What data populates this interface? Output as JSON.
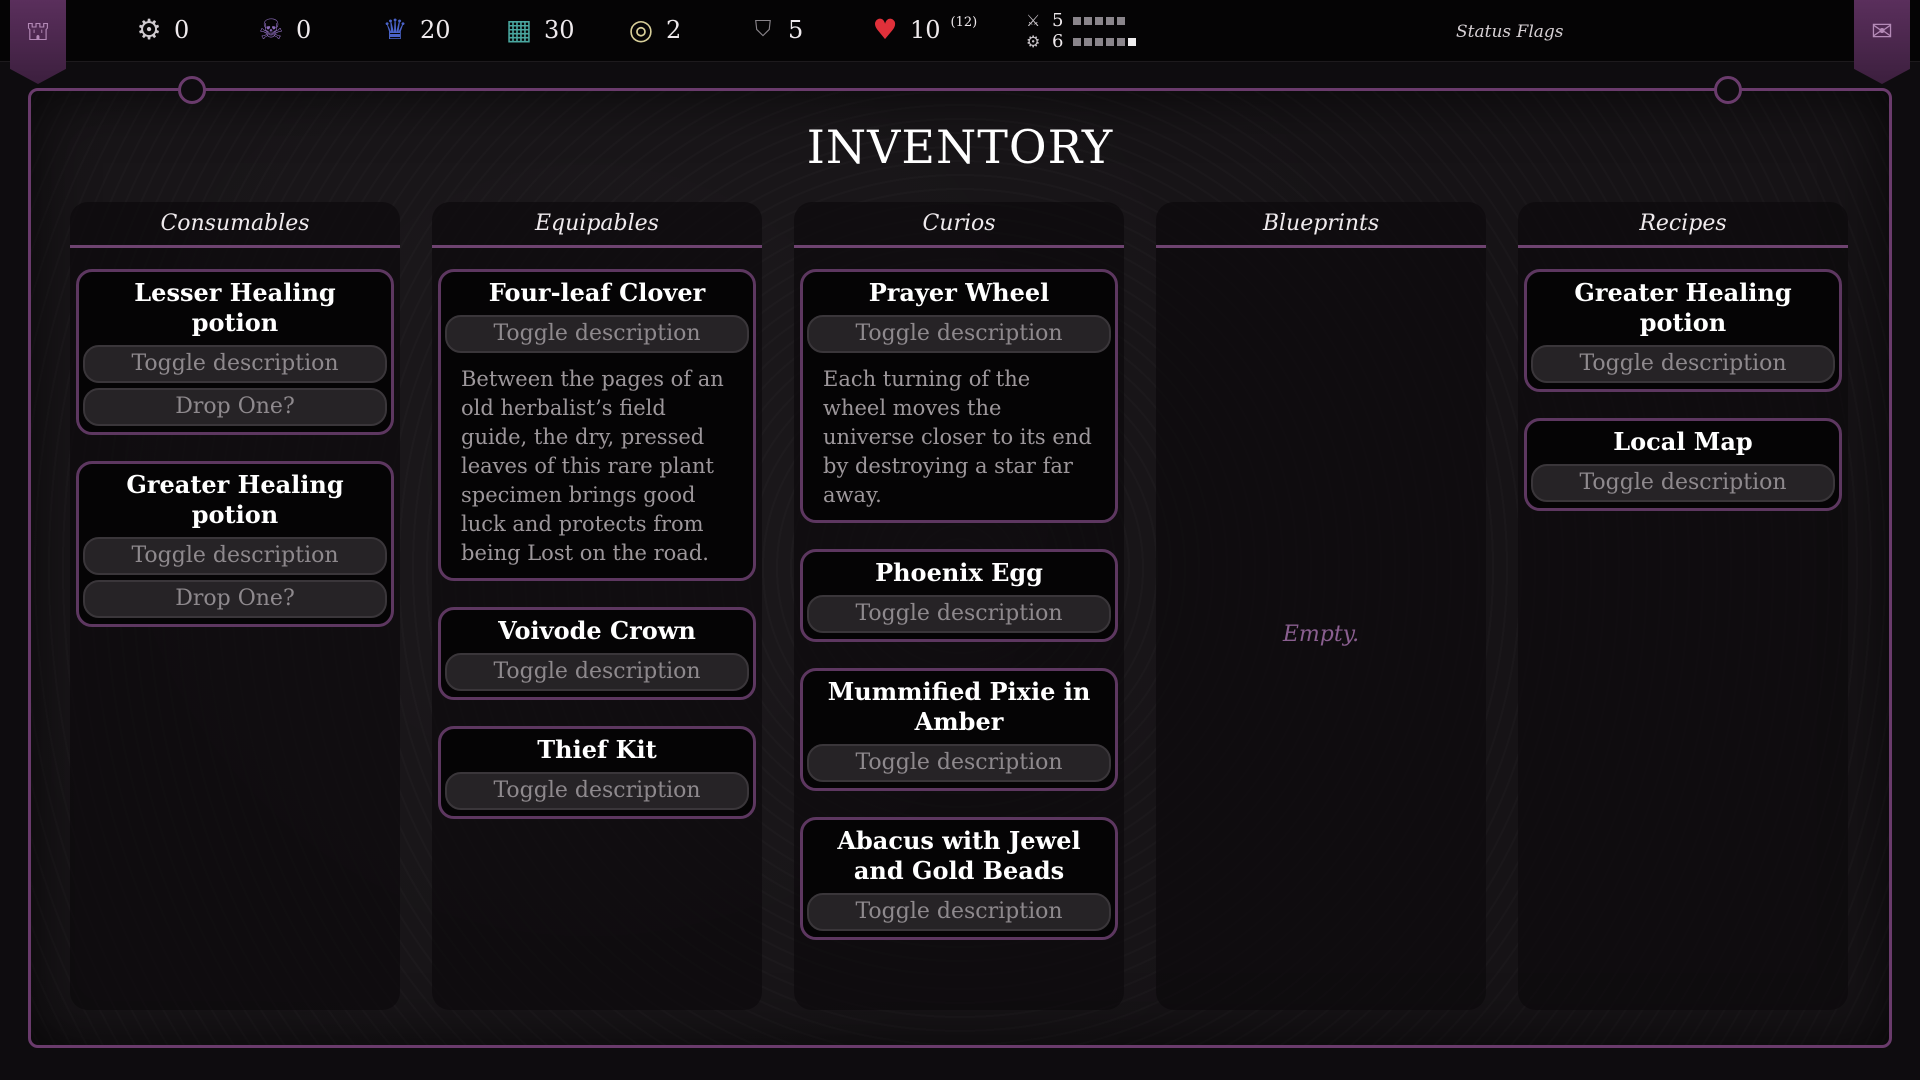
{
  "topbar": {
    "left_tab_icon": "castle-map-icon",
    "right_tab_icon": "scroll-icon",
    "stats": [
      {
        "icon": "gear-icon",
        "value": "0"
      },
      {
        "icon": "skull-gear-icon",
        "value": "0"
      },
      {
        "icon": "trophy-icon",
        "value": "20"
      },
      {
        "icon": "puzzle-map-icon",
        "value": "30"
      },
      {
        "icon": "coin-icon",
        "value": "2"
      },
      {
        "icon": "max-shield-icon",
        "value": "5"
      },
      {
        "icon": "heart-icon",
        "value": "10",
        "sup": "(12)"
      }
    ],
    "party": [
      {
        "icon": "crossed-swords-icon",
        "value": "5",
        "pips": 5,
        "pips_on": 0
      },
      {
        "icon": "bicycle-icon",
        "value": "6",
        "pips": 6,
        "pips_on": 1
      }
    ],
    "status_flags": "Status Flags"
  },
  "title": "INVENTORY",
  "columns": [
    {
      "header": "Consumables",
      "items": [
        {
          "name": "Lesser Healing potion",
          "toggle": "Toggle description",
          "drop": "Drop One?"
        },
        {
          "name": "Greater Healing potion",
          "toggle": "Toggle description",
          "drop": "Drop One?"
        }
      ]
    },
    {
      "header": "Equipables",
      "items": [
        {
          "name": "Four-leaf Clover",
          "toggle": "Toggle description",
          "description": "Between the pages of an old herbalist’s field guide, the dry, pressed leaves of this rare plant specimen brings good luck and protects from being Lost on the road."
        },
        {
          "name": "Voivode Crown",
          "toggle": "Toggle description"
        },
        {
          "name": "Thief Kit",
          "toggle": "Toggle description"
        }
      ]
    },
    {
      "header": "Curios",
      "items": [
        {
          "name": "Prayer Wheel",
          "toggle": "Toggle description",
          "description": "Each turning of the wheel moves the universe closer to its end by destroying a star far away."
        },
        {
          "name": "Phoenix Egg",
          "toggle": "Toggle description"
        },
        {
          "name": "Mummified Pixie in Amber",
          "toggle": "Toggle description"
        },
        {
          "name": "Abacus with Jewel and Gold Beads",
          "toggle": "Toggle description"
        }
      ]
    },
    {
      "header": "Blueprints",
      "items": [],
      "empty_text": "Empty."
    },
    {
      "header": "Recipes",
      "items": [
        {
          "name": "Greater Healing potion",
          "toggle": "Toggle description"
        },
        {
          "name": "Local Map",
          "toggle": "Toggle description"
        }
      ]
    }
  ],
  "colors": {
    "accent": "#6a3b6c",
    "card_border": "#5d3760",
    "empty_text": "#8a5f90",
    "heart": "#e0303a"
  }
}
